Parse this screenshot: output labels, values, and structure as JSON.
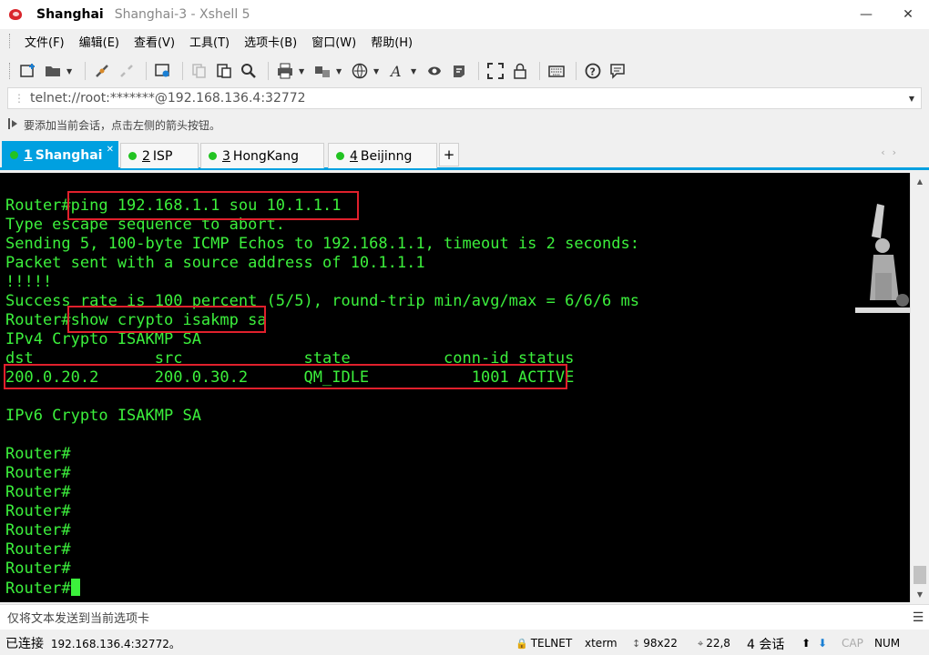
{
  "window": {
    "title_strong": "Shanghai",
    "title_rest": "Shanghai-3 - Xshell 5",
    "minimize": "—",
    "close": "✕"
  },
  "menu": [
    "文件(F)",
    "编辑(E)",
    "查看(V)",
    "工具(T)",
    "选项卡(B)",
    "窗口(W)",
    "帮助(H)"
  ],
  "address": {
    "value": "telnet://root:*******@192.168.136.4:32772"
  },
  "hint": "要添加当前会话，点击左侧的箭头按钮。",
  "tabs": [
    {
      "num": "1",
      "label": "Shanghai",
      "active": true
    },
    {
      "num": "2",
      "label": "ISP"
    },
    {
      "num": "3",
      "label": "HongKang"
    },
    {
      "num": "4",
      "label": "Beijinng"
    }
  ],
  "tab_add": "+",
  "terminal": {
    "lines": [
      "Router#ping 192.168.1.1 sou 10.1.1.1",
      "Type escape sequence to abort.",
      "Sending 5, 100-byte ICMP Echos to 192.168.1.1, timeout is 2 seconds:",
      "Packet sent with a source address of 10.1.1.1",
      "!!!!!",
      "Success rate is 100 percent (5/5), round-trip min/avg/max = 6/6/6 ms",
      "Router#show crypto isakmp sa",
      "IPv4 Crypto ISAKMP SA",
      "dst             src             state          conn-id status",
      "200.0.20.2      200.0.30.2      QM_IDLE           1001 ACTIVE",
      "",
      "IPv6 Crypto ISAKMP SA",
      "",
      "Router#",
      "Router#",
      "Router#",
      "Router#",
      "Router#",
      "Router#",
      "Router#",
      "Router#"
    ],
    "text_color": "#3cf03c",
    "background": "#000000",
    "highlight_color": "#e0202c"
  },
  "compose": {
    "placeholder": "仅将文本发送到当前选项卡"
  },
  "status": {
    "connected_label": "已连接",
    "connected_host": "192.168.136.4:32772。",
    "protocol": "TELNET",
    "term": "xterm",
    "size": "98x22",
    "cursor": "22,8",
    "sessions": "4 会话",
    "caps": "CAP",
    "num": "NUM"
  },
  "colors": {
    "accent": "#00a0e0",
    "online_dot": "#22c322"
  }
}
